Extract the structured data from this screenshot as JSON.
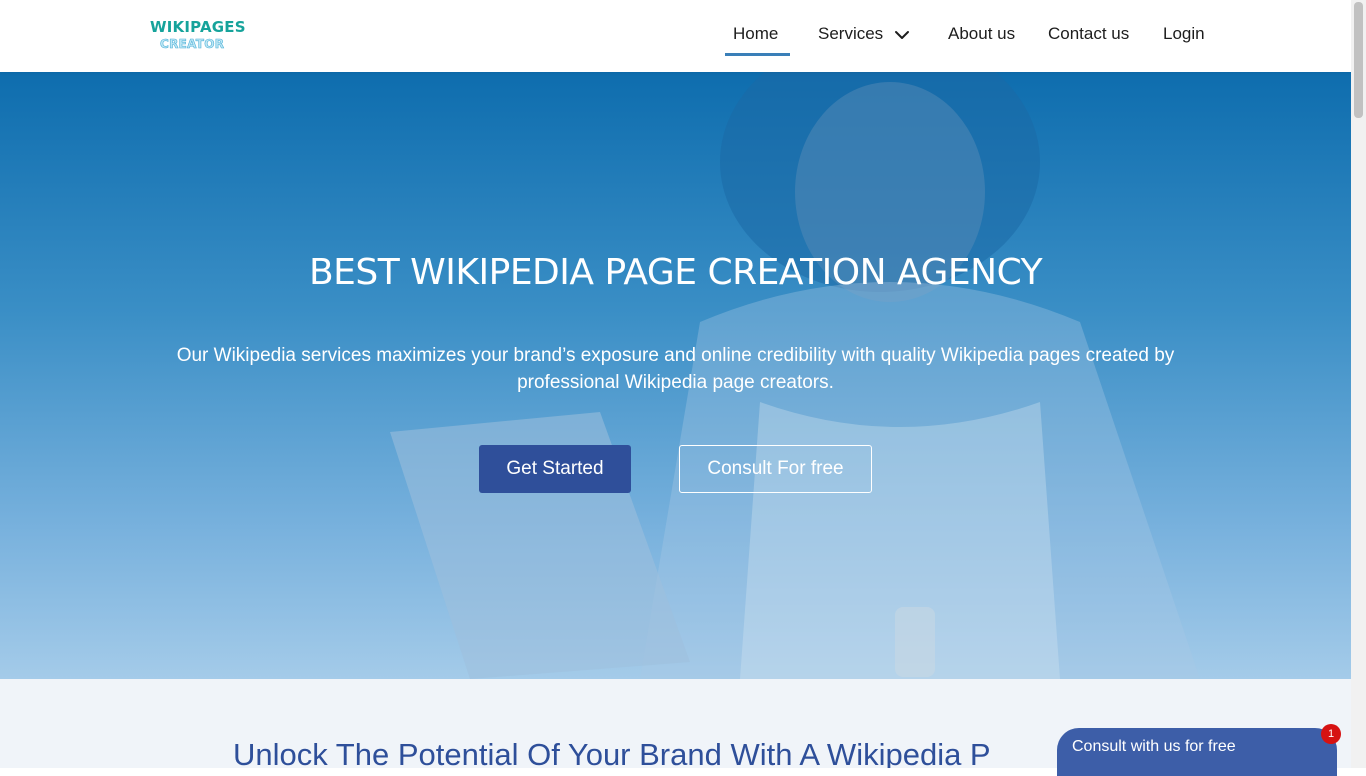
{
  "brand": {
    "logo_top": "WIKIPAGES",
    "logo_bottom": "CREATOR"
  },
  "nav": {
    "items": [
      {
        "label": "Home",
        "active": true
      },
      {
        "label": "Services",
        "has_dropdown": true
      },
      {
        "label": "About us"
      },
      {
        "label": "Contact us"
      },
      {
        "label": "Login"
      }
    ]
  },
  "hero": {
    "title": "BEST WIKIPEDIA PAGE CREATION AGENCY",
    "subtitle": "Our Wikipedia services maximizes your brand’s exposure and online credibility with quality Wikipedia pages created by professional Wikipedia page creators.",
    "primary_button": "Get Started",
    "secondary_button": "Consult For free"
  },
  "section2": {
    "title": "Unlock The Potential Of Your Brand With A Wikipedia P"
  },
  "chat": {
    "label": "Consult with us for free",
    "badge": "1"
  },
  "colors": {
    "accent_blue": "#2f4f9a",
    "logo_teal": "#16a39b",
    "badge_red": "#d61212"
  },
  "icons": {
    "services_dropdown": "chevron-down-icon"
  }
}
